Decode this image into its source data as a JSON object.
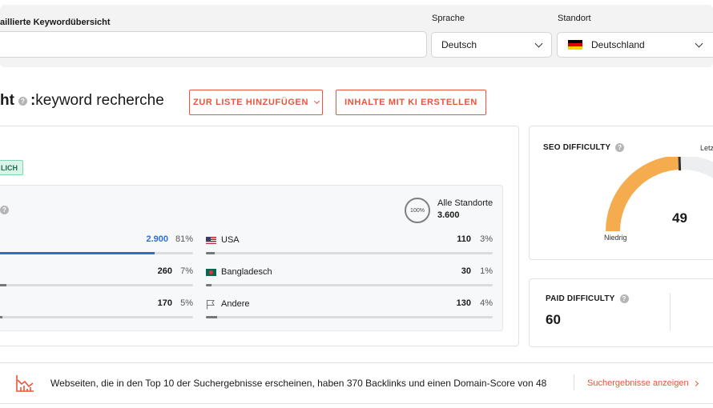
{
  "search": {
    "label": "aillierte Keywordübersicht",
    "value": "",
    "language_label": "Sprache",
    "language_value": "Deutsch",
    "location_label": "Standort",
    "location_value": "Deutschland"
  },
  "header": {
    "title_bold": "ht",
    "title_separator": ":",
    "title_keyword": "keyword recherche",
    "add_to_list_button": "ZUR LISTE HINZUFÜGEN",
    "ai_content_button": "INHALTE MIT KI ERSTELLEN"
  },
  "main": {
    "badge": "LICH",
    "all_locations": {
      "ring_label": "100%",
      "label": "Alle Standorte",
      "value": "3.600"
    },
    "left_rows": [
      {
        "value": "2.900",
        "percent": "81%",
        "share": 0.81
      },
      {
        "value": "260",
        "percent": "7%",
        "share": 0.07
      },
      {
        "value": "170",
        "percent": "5%",
        "share": 0.05
      }
    ],
    "right_rows": [
      {
        "name": "USA",
        "value": "110",
        "percent": "3%",
        "share": 0.03,
        "icon": "flag-us-icon"
      },
      {
        "name": "Bangladesch",
        "value": "30",
        "percent": "1%",
        "share": 0.01,
        "icon": "flag-bd-icon"
      },
      {
        "name": "Andere",
        "value": "130",
        "percent": "4%",
        "share": 0.04,
        "icon": "flag-outline-icon"
      }
    ]
  },
  "seo_difficulty": {
    "title": "SEO DIFFICULTY",
    "last_label": "Letz",
    "value": "49",
    "level": "Niedrig",
    "score": 49,
    "colors": {
      "fill": "#f5ac4f",
      "track": "#eceef0",
      "marker": "#333333"
    }
  },
  "paid_difficulty": {
    "title": "PAID DIFFICULTY",
    "value": "60"
  },
  "banner": {
    "text": "Webseiten, die in den Top 10 der Suchergebnisse erscheinen, haben 370 Backlinks und einen Domain-Score von 48",
    "link": "Suchergebnisse anzeigen"
  },
  "colors": {
    "accent": "#e8553a",
    "blue": "#2b6fd6",
    "badge_bg": "#d9f5ea"
  }
}
